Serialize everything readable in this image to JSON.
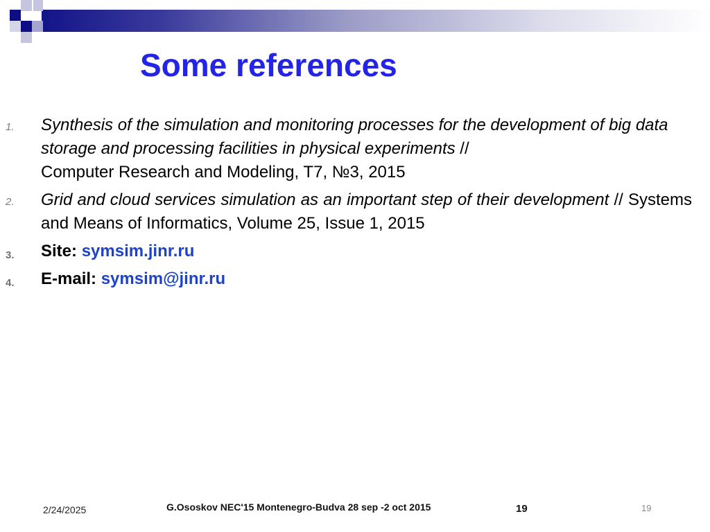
{
  "slide": {
    "title": "Some references",
    "references": [
      {
        "number": "1.",
        "title": "Synthesis of the simulation and monitoring processes for the development of big data storage and processing facilities in physical experiments",
        "separator": " // ",
        "source": "Computer Research and Modeling, T7, №3, 2015"
      },
      {
        "number": "2.",
        "title": "Grid and cloud services simulation as an important step of their development",
        "separator": " // ",
        "source": "Systems and Means of Informatics, Volume 25, Issue 1, 2015"
      }
    ],
    "site": {
      "number": "3.",
      "label": "Site:",
      "value": "symsim.jinr.ru"
    },
    "email": {
      "number": "4.",
      "label": "E-mail:",
      "value": "symsim@jinr.ru"
    }
  },
  "footer": {
    "date": "2/24/2025",
    "center_text": "G.Ososkov NEC'15 Montenegro-Budva 28 sep -2 oct 2015",
    "slide_number_bold": "19",
    "page_number": "19"
  },
  "colors": {
    "title": "#2424e6",
    "link": "#1d43c9",
    "header_dark": "#14148a"
  }
}
